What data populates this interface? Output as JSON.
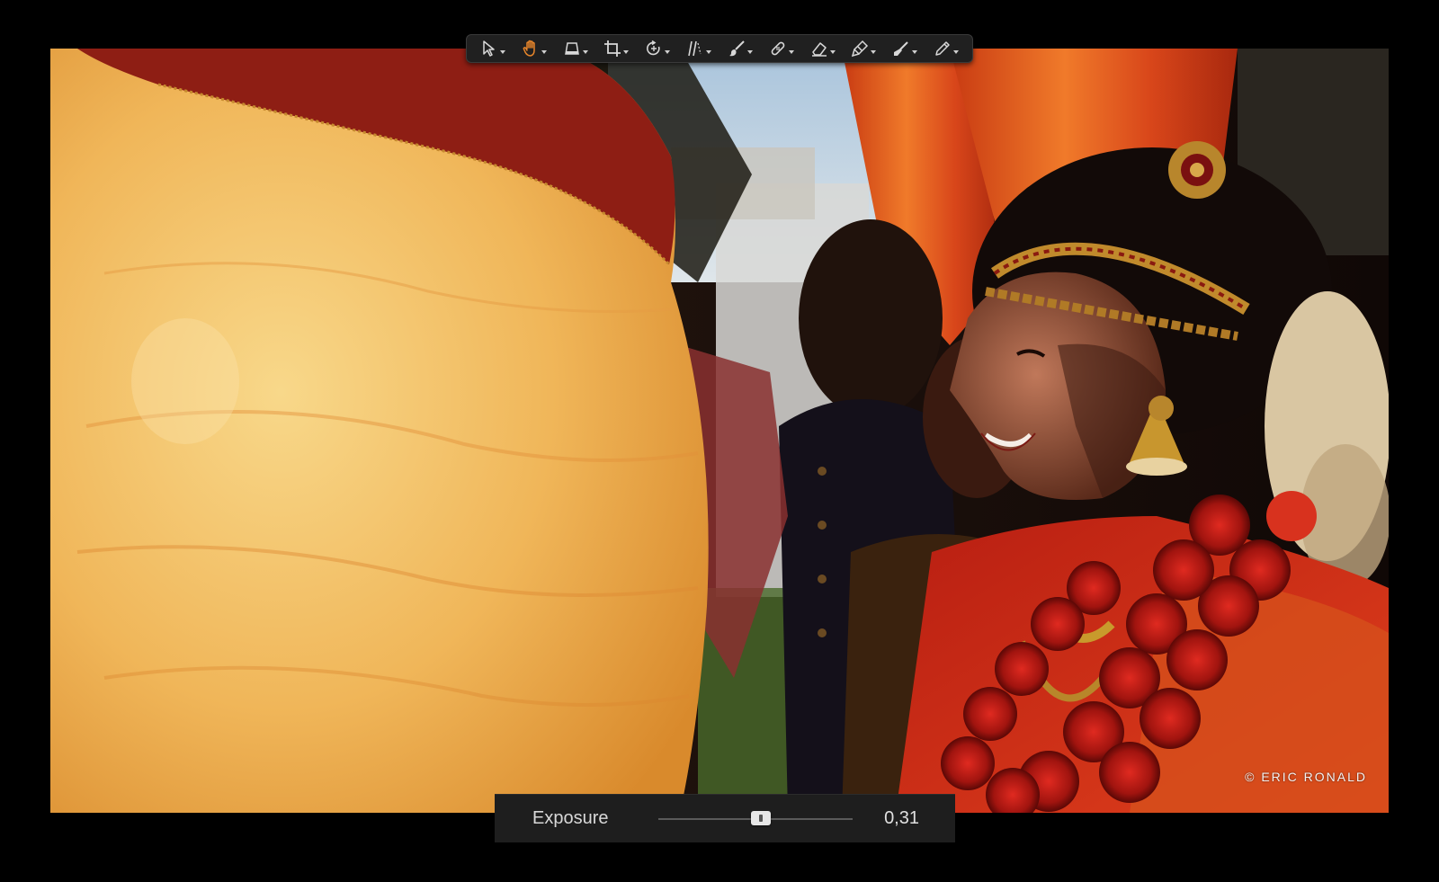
{
  "app": {
    "accent_color": "#e8862a"
  },
  "toolbar": {
    "tools": [
      {
        "name": "select-tool",
        "icon": "arrow-pointer-icon",
        "active": false
      },
      {
        "name": "hand-tool",
        "icon": "hand-icon",
        "active": true
      },
      {
        "name": "horizon-tool",
        "icon": "perspective-icon",
        "active": false
      },
      {
        "name": "crop-tool",
        "icon": "crop-icon",
        "active": false
      },
      {
        "name": "rotate-tool",
        "icon": "rotate-icon",
        "active": false
      },
      {
        "name": "gradient-tool",
        "icon": "gradient-icon",
        "active": false
      },
      {
        "name": "brush-tool",
        "icon": "brush-icon",
        "active": false
      },
      {
        "name": "heal-tool",
        "icon": "bandage-icon",
        "active": false
      },
      {
        "name": "eraser-tool",
        "icon": "eraser-icon",
        "active": false
      },
      {
        "name": "clone-tool",
        "icon": "clone-stamp-icon",
        "active": false
      },
      {
        "name": "fill-tool",
        "icon": "fill-brush-icon",
        "active": false
      },
      {
        "name": "pen-tool",
        "icon": "pen-icon",
        "active": false
      }
    ]
  },
  "photo": {
    "credit": "© ERIC RONALD"
  },
  "adjustment": {
    "label": "Exposure",
    "value_text": "0,31",
    "slider_fraction": 0.53
  }
}
